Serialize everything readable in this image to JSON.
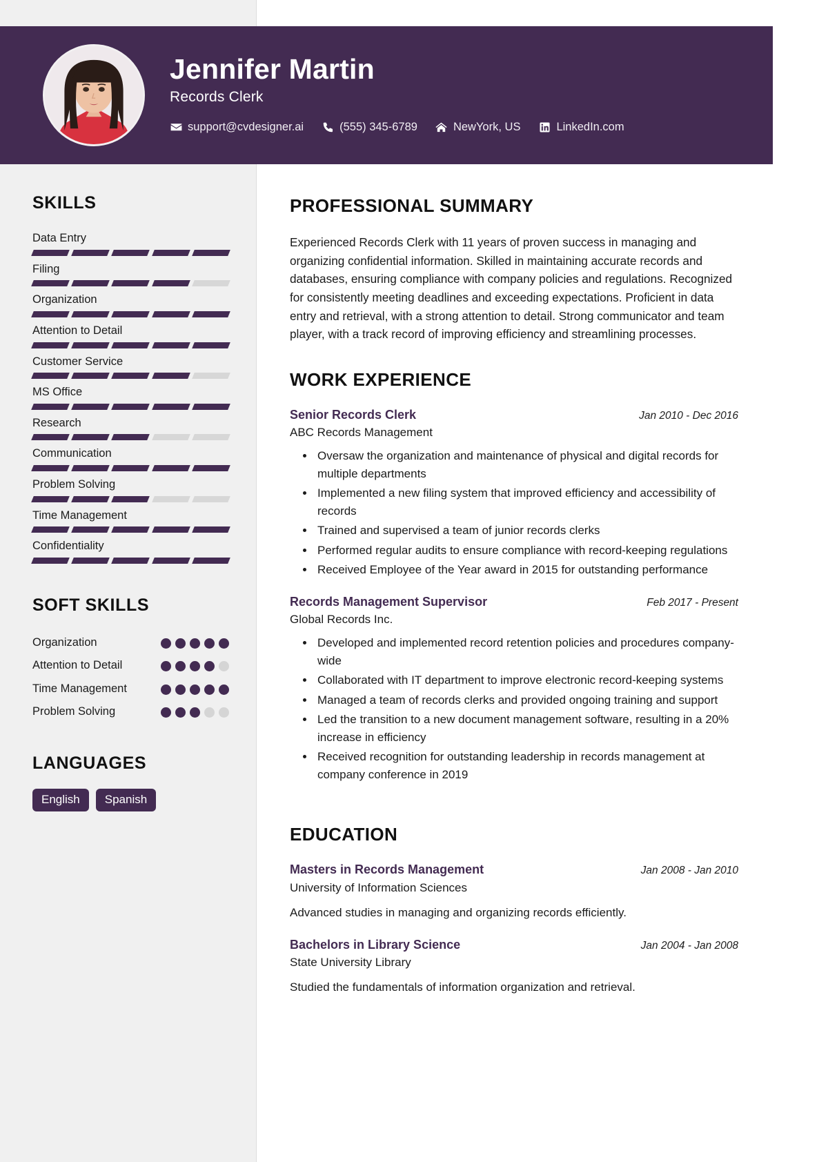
{
  "theme": {
    "accent": "#432b52",
    "sidebar_bg": "#f0f0f0",
    "text": "#1b1b1b",
    "muted_bar": "#d7d7d7"
  },
  "header": {
    "name": "Jennifer Martin",
    "job_title": "Records Clerk",
    "contacts": [
      {
        "icon": "envelope-icon",
        "text": "support@cvdesigner.ai"
      },
      {
        "icon": "phone-icon",
        "text": "(555) 345-6789"
      },
      {
        "icon": "home-icon",
        "text": "NewYork, US"
      },
      {
        "icon": "linkedin-icon",
        "text": "LinkedIn.com"
      }
    ]
  },
  "sidebar": {
    "skills_heading": "SKILLS",
    "skills": [
      {
        "name": "Data Entry",
        "level": 5
      },
      {
        "name": "Filing",
        "level": 4
      },
      {
        "name": "Organization",
        "level": 5
      },
      {
        "name": "Attention to Detail",
        "level": 5
      },
      {
        "name": "Customer Service",
        "level": 4
      },
      {
        "name": "MS Office",
        "level": 5
      },
      {
        "name": "Research",
        "level": 3
      },
      {
        "name": "Communication",
        "level": 5
      },
      {
        "name": "Problem Solving",
        "level": 3
      },
      {
        "name": "Time Management",
        "level": 5
      },
      {
        "name": "Confidentiality",
        "level": 5
      }
    ],
    "soft_skills_heading": "SOFT SKILLS",
    "soft_skills": [
      {
        "name": "Organization",
        "level": 5
      },
      {
        "name": "Attention to Detail",
        "level": 4
      },
      {
        "name": "Time Management",
        "level": 5
      },
      {
        "name": "Problem Solving",
        "level": 3
      }
    ],
    "languages_heading": "LANGUAGES",
    "languages": [
      "English",
      "Spanish"
    ]
  },
  "main": {
    "summary_heading": "PROFESSIONAL SUMMARY",
    "summary_text": "Experienced Records Clerk with 11 years of proven success in managing and organizing confidential information. Skilled in maintaining accurate records and databases, ensuring compliance with company policies and regulations. Recognized for consistently meeting deadlines and exceeding expectations. Proficient in data entry and retrieval, with a strong attention to detail. Strong communicator and team player, with a track record of improving efficiency and streamlining processes.",
    "work_heading": "WORK EXPERIENCE",
    "work": [
      {
        "title": "Senior Records Clerk",
        "date": "Jan 2010 - Dec 2016",
        "org": "ABC Records Management",
        "bullets": [
          "Oversaw the organization and maintenance of physical and digital records for multiple departments",
          "Implemented a new filing system that improved efficiency and accessibility of records",
          "Trained and supervised a team of junior records clerks",
          "Performed regular audits to ensure compliance with record-keeping regulations",
          "Received Employee of the Year award in 2015 for outstanding performance"
        ]
      },
      {
        "title": "Records Management Supervisor",
        "date": "Feb 2017 - Present",
        "org": "Global Records Inc.",
        "bullets": [
          "Developed and implemented record retention policies and procedures company-wide",
          "Collaborated with IT department to improve electronic record-keeping systems",
          "Managed a team of records clerks and provided ongoing training and support",
          "Led the transition to a new document management software, resulting in a 20% increase in efficiency",
          "Received recognition for outstanding leadership in records management at company conference in 2019"
        ]
      }
    ],
    "education_heading": "EDUCATION",
    "education": [
      {
        "title": "Masters in Records Management",
        "date": "Jan 2008 - Jan 2010",
        "org": "University of Information Sciences",
        "desc": "Advanced studies in managing and organizing records efficiently."
      },
      {
        "title": "Bachelors in Library Science",
        "date": "Jan 2004 - Jan 2008",
        "org": "State University Library",
        "desc": "Studied the fundamentals of information organization and retrieval."
      }
    ]
  }
}
